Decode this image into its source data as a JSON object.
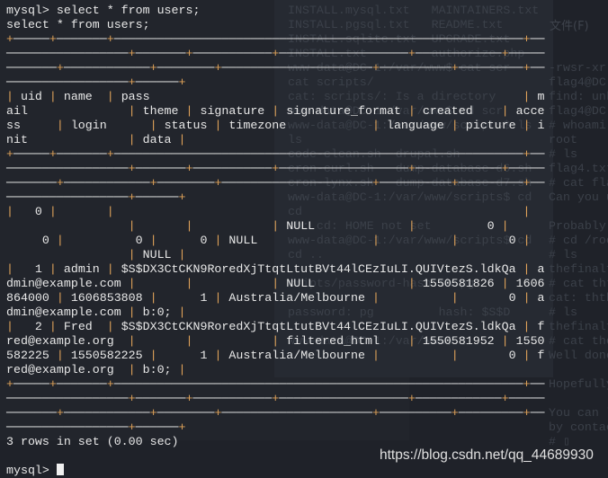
{
  "terminal": {
    "prompt": "mysql> ",
    "command": "select * from users;",
    "echo": "select * from users;",
    "result_summary": "3 rows in set (0.00 sec)",
    "wrap_columns": 75,
    "colors": {
      "background": "#1f2229",
      "text": "#e8e8e8",
      "table_border": "#e0a35a"
    }
  },
  "table": {
    "columns": [
      "uid",
      "name",
      "pass",
      "mail",
      "theme",
      "signature",
      "signature_format",
      "created",
      "access",
      "login",
      "status",
      "timezone",
      "language",
      "picture",
      "init",
      "data"
    ],
    "numeric_columns": [
      "uid",
      "created",
      "access",
      "login",
      "status",
      "picture"
    ],
    "rows": [
      [
        "0",
        "",
        "",
        "",
        "",
        "",
        "NULL",
        "0",
        "0",
        "0",
        "0",
        "NULL",
        "",
        "0",
        "",
        "NULL"
      ],
      [
        "1",
        "admin",
        "$S$DX3CtCKN9RoredXjTtqtLtutBVt44lCEzIuLI.QUIVtezS.ldkQa",
        "admin@example.com",
        "",
        "",
        "NULL",
        "1550581826",
        "1606864000",
        "1606853808",
        "1",
        "Australia/Melbourne",
        "",
        "0",
        "admin@example.com",
        "b:0;"
      ],
      [
        "2",
        "Fred",
        "$S$DX3CtCKN9RoredXjTtqtLtutBVt44lCEzIuLI.QUIVtezS.ldkQa",
        "fred@example.org",
        "",
        "",
        "filtered_html",
        "1550581952",
        "1550582225",
        "1550582225",
        "1",
        "Australia/Melbourne",
        "",
        "0",
        "fred@example.org",
        "b:0;"
      ]
    ]
  },
  "background_window_mid": {
    "lines": [
      "INSTALL.mysql.txt   MAINTAINERS.txt",
      "INSTALL.pgsql.txt   README.txt",
      "INSTALL.sqlite.txt  UPGRADE.txt",
      "INSTALL.txt         authorize.php",
      "www-data@DC-1:/var/www$ cat scr",
      "cat scripts/",
      "cat: scripts/: Is a directory",
      "www-data@DC-1:/var/www$ cd scr",
      "www-data@DC-1:/var/www/scripts$ ls",
      "ls",
      "code-clean.sh  drupal.sh",
      "cron-curl.sh   dump-database-d6.sh",
      "cron-lynx.sh   dump-database-d7.sh",
      "www-data@DC-1:/var/www/scripts$ cd",
      "cd",
      "sh: cd: HOME not set",
      "www-data@DC-1:/var/www/scripts$ cd",
      "cd ..",
      "",
      "cripts/password-hash.sh pg",
      "",
      "password: pg         hash: $S$D",
      "",
      "www-data@DC-1:/var/www$ ▯"
    ]
  },
  "background_window_right": {
    "menu": "文件(F)",
    "lines": [
      "",
      "",
      "",
      "",
      "-rwsr-xr-x",
      "flag4@DC-",
      "find: unk",
      "flag4@DC-",
      "# whoami",
      "root",
      "# ls",
      "flag4.txt",
      "# cat fla",
      "Can you u",
      "",
      "Probably",
      "# cd /roo",
      "# ls",
      "thefinalf",
      "# cat tht",
      "cat: thth",
      "# ls",
      "thefinalf",
      "# cat the",
      "Well done",
      "",
      "Hopefully",
      "",
      "You can l",
      "by contac",
      "# ▯"
    ]
  },
  "watermark": "https://blog.csdn.net/qq_44689930"
}
